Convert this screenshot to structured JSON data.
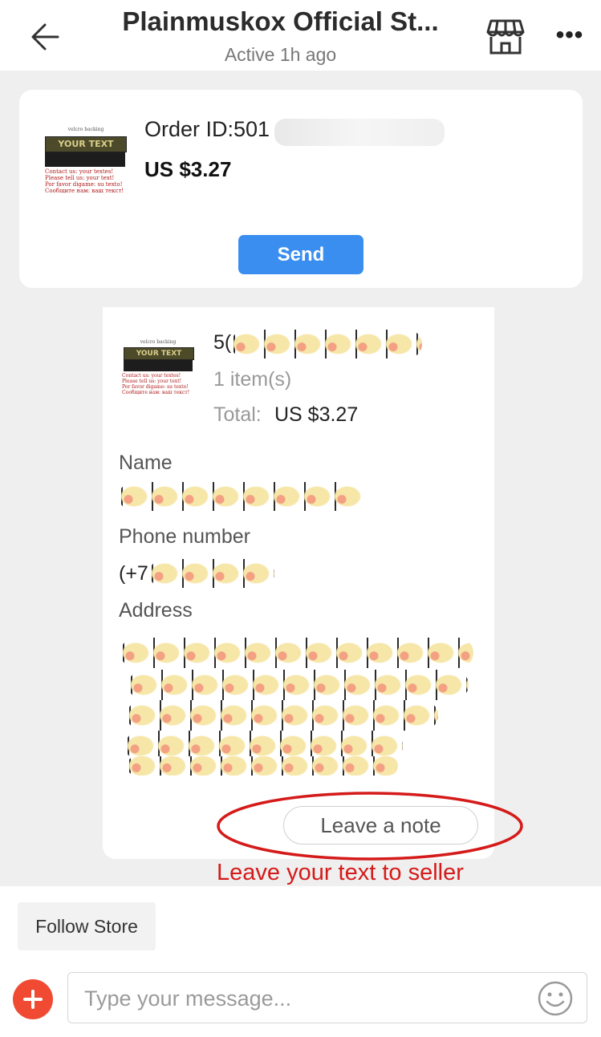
{
  "header": {
    "title": "Plainmuskox Official St...",
    "subtitle": "Active 1h ago",
    "back_icon": "arrow-left-icon",
    "store_icon": "storefront-icon",
    "more_label": "•••"
  },
  "order_card": {
    "product_thumb": {
      "caption": "velcro backing",
      "patch_text": "YOUR TEXT",
      "lines": [
        "Contact us: your textes!",
        "Please tell us: your text!",
        "Por favor digame: su texto!",
        "Сообщите нам: ваш текст!"
      ]
    },
    "order_id_label": "Order ID:501",
    "price": "US $3.27",
    "send_label": "Send"
  },
  "message": {
    "order_number_prefix": "5(",
    "items": "1 item(s)",
    "total_label": "Total:",
    "total_value": "US $3.27",
    "name_label": "Name",
    "phone_label": "Phone number",
    "phone_prefix": "(+7",
    "address_label": "Address",
    "note_button": "Leave a note"
  },
  "annotation": {
    "text": "Leave your text to seller",
    "color": "#d51a1a"
  },
  "bottom": {
    "follow_label": "Follow Store",
    "add_icon": "plus-icon",
    "message_placeholder": "Type your message...",
    "emoji_icon": "smiley-icon"
  },
  "colors": {
    "send_button": "#3a8ef0",
    "add_button": "#f04a33",
    "page_bg": "#efefef"
  }
}
